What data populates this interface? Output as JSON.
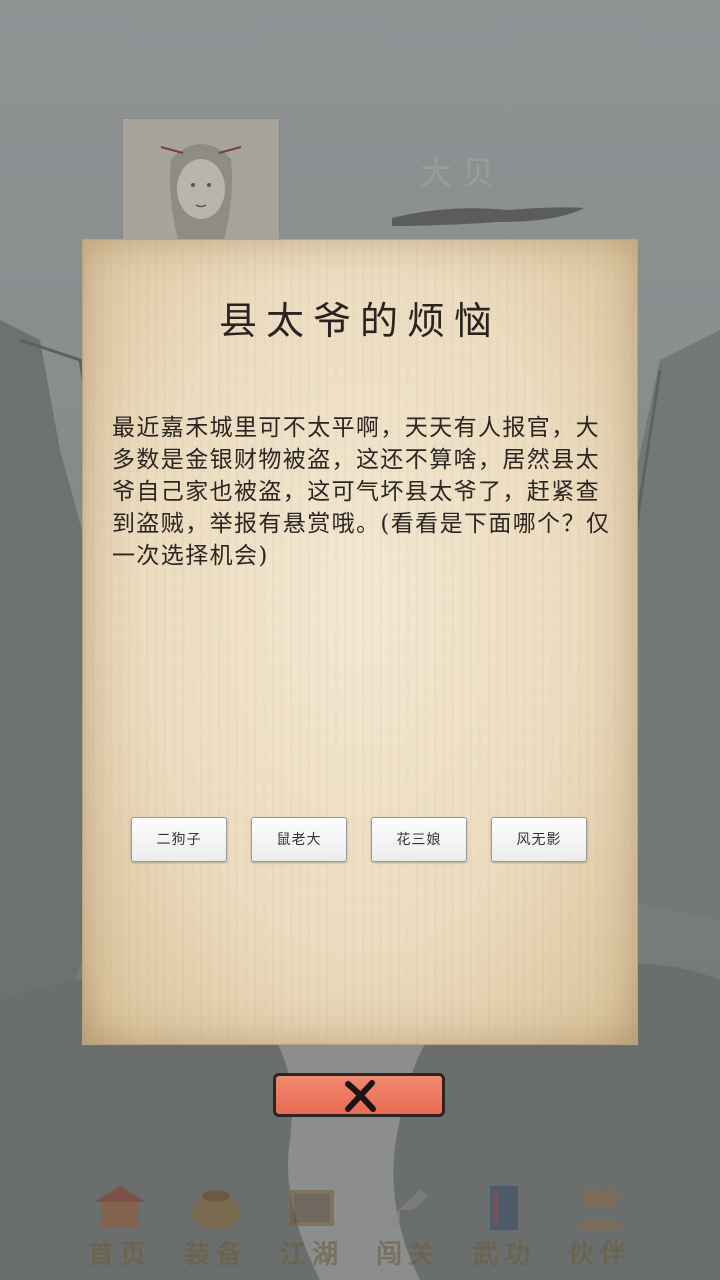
{
  "hero": {
    "name": "大贝"
  },
  "dialog": {
    "title": "县太爷的烦恼",
    "body": "最近嘉禾城里可不太平啊，天天有人报官，大多数是金银财物被盗，这还不算啥，居然县太爷自己家也被盗，这可气坏县太爷了，赶紧查到盗贼，举报有悬赏哦。(看看是下面哪个？仅一次选择机会)",
    "choices": [
      "二狗子",
      "鼠老大",
      "花三娘",
      "风无影"
    ],
    "close_icon": "close-x-icon"
  },
  "bottom_nav": {
    "items": [
      {
        "label": "首页",
        "icon": "home-pavilion-icon"
      },
      {
        "label": "装备",
        "icon": "equipment-bag-icon"
      },
      {
        "label": "江湖",
        "icon": "map-scroll-icon"
      },
      {
        "label": "闯关",
        "icon": "sword-challenge-icon"
      },
      {
        "label": "武功",
        "icon": "martial-book-icon"
      },
      {
        "label": "伙伴",
        "icon": "partners-icon"
      }
    ]
  },
  "colors": {
    "overlay": "#7f8283",
    "paper": "#ecdcc0",
    "close_button": "#ec775e",
    "nav_label": "#6a5f3e"
  }
}
